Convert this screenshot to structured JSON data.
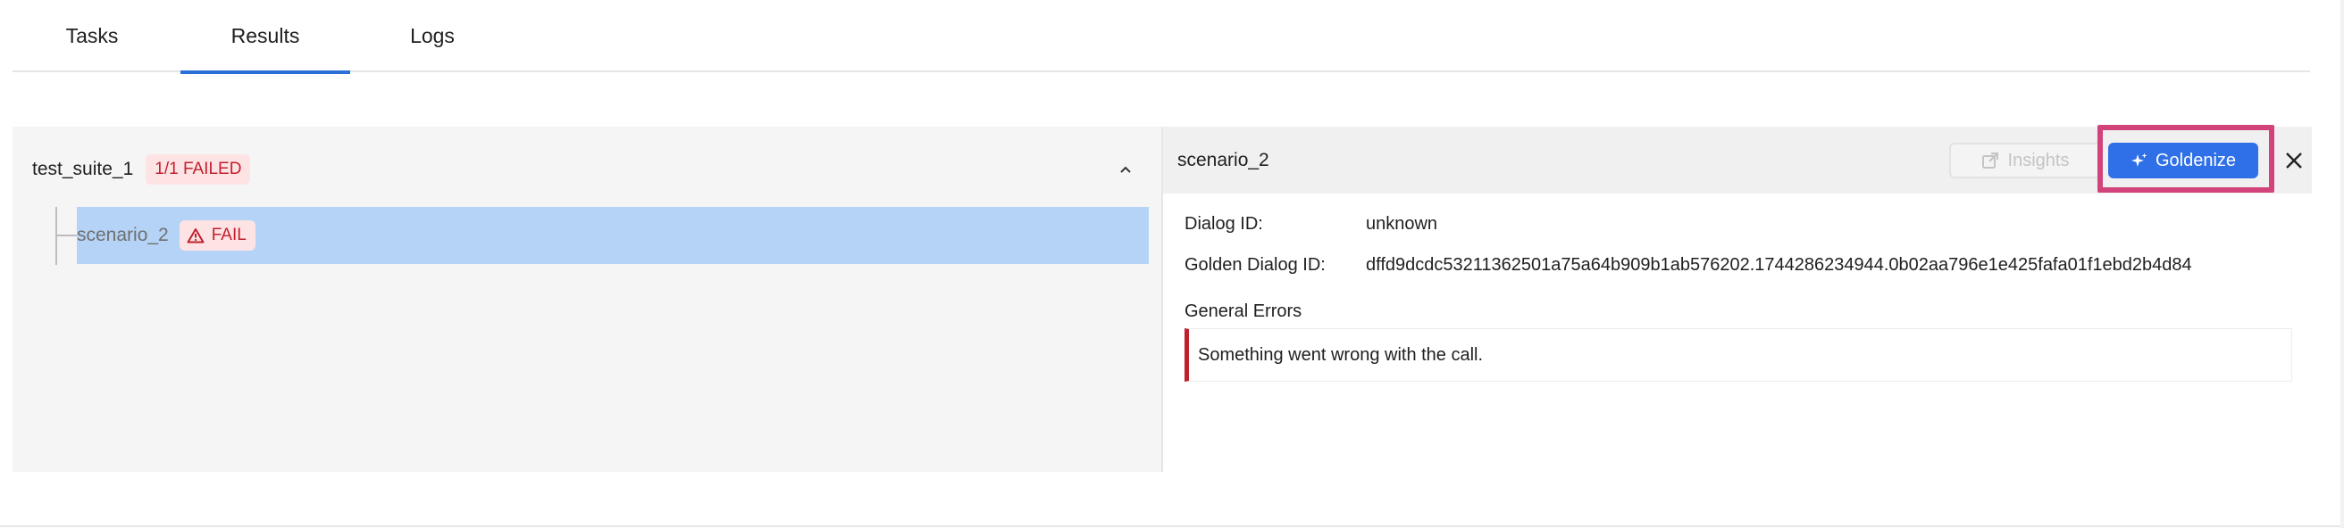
{
  "tabs": [
    {
      "label": "Tasks",
      "active": false
    },
    {
      "label": "Results",
      "active": true
    },
    {
      "label": "Logs",
      "active": false
    }
  ],
  "suite": {
    "name": "test_suite_1",
    "status_badge": "1/1 FAILED",
    "scenarios": [
      {
        "name": "scenario_2",
        "status": "FAIL",
        "selected": true
      }
    ]
  },
  "detail": {
    "title": "scenario_2",
    "insights_label": "Insights",
    "goldenize_label": "Goldenize",
    "fields": [
      {
        "label": "Dialog ID:",
        "value": "unknown"
      },
      {
        "label": "Golden Dialog ID:",
        "value": "dffd9dcdc53211362501a75a64b909b1ab576202.1744286234944.0b02aa796e1e425fafa01f1ebd2b4d84"
      }
    ],
    "general_errors_title": "General Errors",
    "errors": [
      "Something went wrong with the call."
    ]
  },
  "colors": {
    "accent": "#2a6fd6",
    "goldenize_bg": "#2f6fe8",
    "fail": "#c0202e",
    "fail_bg": "#fde3e4",
    "selected_row": "#b5d3f7",
    "highlight": "#d1437a"
  },
  "icons": {
    "collapse": "chevron-up-icon",
    "fail": "warning-triangle-icon",
    "insights": "external-link-icon",
    "goldenize": "sparkle-icon",
    "close": "close-icon"
  }
}
